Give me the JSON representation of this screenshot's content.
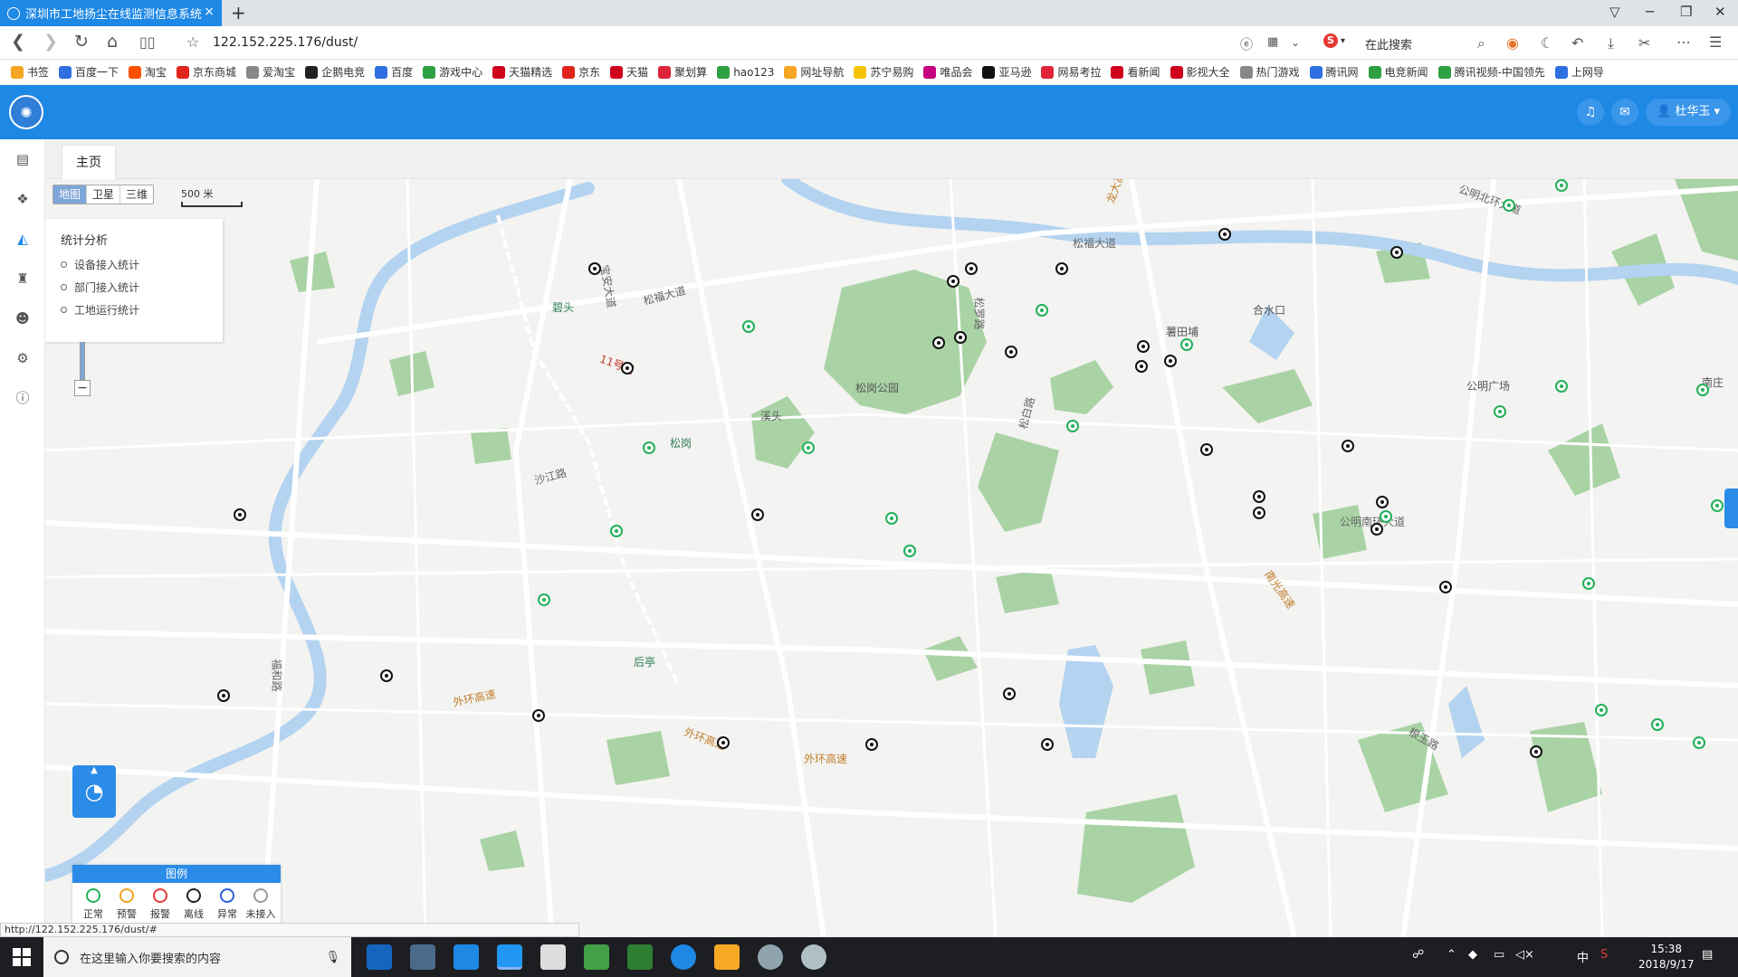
{
  "browser": {
    "tab_title": "深圳市工地扬尘在线监测信息系统",
    "tab_close": "×",
    "new_tab": "+",
    "url": "122.152.225.176/dust/",
    "search_placeholder": "在此搜索",
    "bookmarks": [
      {
        "label": "书签",
        "icon": "star-icon",
        "color": "#f5a623"
      },
      {
        "label": "百度一下",
        "icon": "baidu-paw-icon",
        "color": "#2f6fe0"
      },
      {
        "label": "淘宝",
        "icon": "taobao-icon",
        "color": "#ff5000"
      },
      {
        "label": "京东商城",
        "icon": "jd-icon",
        "color": "#e1251b"
      },
      {
        "label": "爱淘宝",
        "icon": "aitaobao-icon",
        "color": "#888888"
      },
      {
        "label": "企鹅电竞",
        "icon": "penguin-icon",
        "color": "#222222"
      },
      {
        "label": "百度",
        "icon": "baidu-paw-icon",
        "color": "#2f6fe0"
      },
      {
        "label": "游戏中心",
        "icon": "gamepad-icon",
        "color": "#2ea043"
      },
      {
        "label": "天猫精选",
        "icon": "tmall-icon",
        "color": "#d0021b"
      },
      {
        "label": "京东",
        "icon": "jd-icon",
        "color": "#e1251b"
      },
      {
        "label": "天猫",
        "icon": "tmall-icon",
        "color": "#d0021b"
      },
      {
        "label": "聚划算",
        "icon": "juhuasuan-icon",
        "color": "#e0243a"
      },
      {
        "label": "hao123",
        "icon": "hao123-icon",
        "color": "#2ea043"
      },
      {
        "label": "网址导航",
        "icon": "nav-icon",
        "color": "#f5a623"
      },
      {
        "label": "苏宁易购",
        "icon": "suning-icon",
        "color": "#f5c400"
      },
      {
        "label": "唯品会",
        "icon": "vip-icon",
        "color": "#c6007e"
      },
      {
        "label": "亚马逊",
        "icon": "amazon-icon",
        "color": "#111111"
      },
      {
        "label": "网易考拉",
        "icon": "kaola-icon",
        "color": "#e0243a"
      },
      {
        "label": "看新闻",
        "icon": "news-icon",
        "color": "#d0021b"
      },
      {
        "label": "影视大全",
        "icon": "play-icon",
        "color": "#d0021b"
      },
      {
        "label": "热门游戏",
        "icon": "globe-icon",
        "color": "#888888"
      },
      {
        "label": "腾讯网",
        "icon": "tencent-icon",
        "color": "#2f6fe0"
      },
      {
        "label": "电竞新闻",
        "icon": "esports-icon",
        "color": "#2ea043"
      },
      {
        "label": "腾讯视频-中国领先",
        "icon": "tencent-video-icon",
        "color": "#2ea043"
      },
      {
        "label": "上网导",
        "icon": "ie-icon",
        "color": "#2f6fe0"
      }
    ]
  },
  "app": {
    "user_name": "杜华玉",
    "home_tab": "主页",
    "map_types": [
      {
        "label": "地图",
        "active": true
      },
      {
        "label": "卫星",
        "active": false
      },
      {
        "label": "三维",
        "active": false
      }
    ],
    "scale_label": "500 米",
    "stats_menu": {
      "title": "统计分析",
      "items": [
        "设备接入统计",
        "部门接入统计",
        "工地运行统计"
      ]
    },
    "zoom_out": "−",
    "legend": {
      "title": "图例",
      "items": [
        {
          "label": "正常",
          "color": "#21b05a"
        },
        {
          "label": "预警",
          "color": "#f0a020"
        },
        {
          "label": "报警",
          "color": "#e53935"
        },
        {
          "label": "离线",
          "color": "#222222"
        },
        {
          "label": "异常",
          "color": "#2b5fd9"
        },
        {
          "label": "未接入",
          "color": "#999999"
        }
      ]
    },
    "header_color": "#1e88e5",
    "status_url": "http://122.152.225.176/dust/#"
  },
  "map_labels": {
    "roads": [
      "松福大道",
      "松福大道",
      "宝安大道",
      "松罗路",
      "沙江路",
      "松白路",
      "公明北环大道",
      "公明南环大道",
      "福和路",
      "根玉路"
    ],
    "highways": [
      "外环高速",
      "外环高速",
      "外环高速",
      "南光高速",
      "龙大高速"
    ],
    "places": [
      "松岗公园",
      "溪头",
      "合水口",
      "公明广场",
      "南庄",
      "薯田埔"
    ],
    "stations": [
      "碧头",
      "松岗",
      "后亭"
    ],
    "metro_line": "11号线"
  },
  "taskbar": {
    "search_placeholder": "在这里输入你要搜索的内容",
    "time": "15:38",
    "date": "2018/9/17",
    "ime": "中"
  }
}
